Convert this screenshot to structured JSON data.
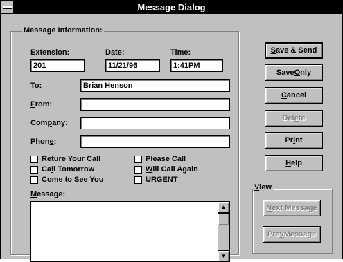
{
  "window": {
    "title": "Message Dialog"
  },
  "info_group": {
    "label": "Message Information:"
  },
  "extension": {
    "label": "Extension:",
    "value": "201"
  },
  "date": {
    "label": "Date:",
    "value": "11/21/96"
  },
  "time": {
    "label": "Time:",
    "value": "1:41PM"
  },
  "to": {
    "label": "To:",
    "value": "Brian Henson"
  },
  "from": {
    "label_pre": "",
    "label_u": "F",
    "label_post": "rom:",
    "value": ""
  },
  "company": {
    "label_pre": "Com",
    "label_u": "p",
    "label_post": "any:",
    "value": ""
  },
  "phone": {
    "label_pre": "Phon",
    "label_u": "e",
    "label_post": ":",
    "value": ""
  },
  "checkboxes": {
    "return_call": {
      "pre": "",
      "u": "R",
      "post": "eture Your Call",
      "checked": false
    },
    "call_tomorrow": {
      "pre": "Ca",
      "u": "l",
      "post": "l Tomorrow",
      "checked": false
    },
    "come_to_see": {
      "pre": "Come to See ",
      "u": "Y",
      "post": "ou",
      "checked": false
    },
    "please_call": {
      "pre": "",
      "u": "P",
      "post": "lease Call",
      "checked": false
    },
    "will_call_again": {
      "pre": "",
      "u": "W",
      "post": "ill Call Again",
      "checked": false
    },
    "urgent": {
      "pre": "",
      "u": "U",
      "post": "RGENT",
      "checked": false
    }
  },
  "message": {
    "label_u": "M",
    "label_post": "essage:",
    "value": ""
  },
  "buttons": {
    "save_send": {
      "u": "S",
      "post": "ave & Send"
    },
    "save_only": {
      "pre": "Save ",
      "u": "O",
      "post": "nly"
    },
    "cancel": {
      "u": "C",
      "post": "ancel"
    },
    "delete": {
      "pre": "Del",
      "u": "e",
      "post": "te"
    },
    "print": {
      "pre": "Pr",
      "u": "i",
      "post": "nt"
    },
    "help": {
      "u": "H",
      "post": "elp"
    }
  },
  "view_group": {
    "label_u": "V",
    "label_post": "iew"
  },
  "view_buttons": {
    "next": {
      "u": "N",
      "post": "ext Message"
    },
    "prev": {
      "pre": "Pre",
      "u": "v",
      "post": " Message"
    }
  },
  "scroll": {
    "up_glyph": "▲",
    "down_glyph": "▼"
  }
}
